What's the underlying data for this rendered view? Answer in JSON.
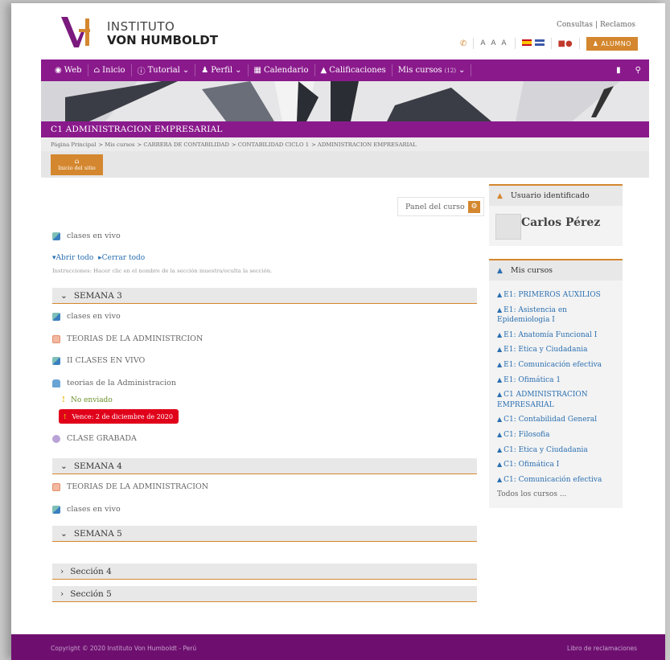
{
  "header": {
    "logo_line1": "INSTITUTO",
    "logo_line2": "VON HUMBOLDT",
    "consultas": "Consultas",
    "reclamos": "Reclamos",
    "font_size_label": "A A A",
    "alumno_button": "ALUMNO"
  },
  "nav": {
    "items": [
      "Web",
      "Inicio",
      "Tutorial",
      "Perfil",
      "Calendario",
      "Calificaciones",
      "Mis cursos"
    ],
    "mis_cursos_count": "(12)"
  },
  "course": {
    "title": "C1 ADMINISTRACION EMPRESARIAL",
    "breadcrumb": [
      "Página Principal",
      "> Mis cursos",
      "> CARRERA DE CONTABILIDAD",
      "> CONTABILIDAD CICLO 1",
      "> ADMINISTRACION EMPRESARIAL"
    ],
    "home_button": "Inicio del sitio"
  },
  "main": {
    "panel_button": "Panel del curso",
    "top_activity": "clases en vivo",
    "expand_all": "Abrir todo",
    "collapse_all": "Cerrar todo",
    "instructions": "Instrucciones: Hacer clic en el nombre de la sección muestra/oculta la sección.",
    "sections": [
      {
        "title": "SEMANA 3",
        "activities": [
          "clases en vivo",
          "TEORIAS DE LA ADMINISTRCION",
          "II CLASES EN VIVO",
          "teorias de la Administracion",
          "CLASE GRABADA"
        ],
        "status": "No enviado",
        "due": "Vence: 2 de diciembre de 2020"
      },
      {
        "title": "SEMANA 4",
        "activities": [
          "TEORIAS DE LA ADMINISTRACION",
          "clases en vivo"
        ]
      },
      {
        "title": "SEMANA 5"
      },
      {
        "title": "Sección 4"
      },
      {
        "title": "Sección 5"
      }
    ]
  },
  "sidebar": {
    "user_block_title": "Usuario identificado",
    "user_name": "Carlos Pérez",
    "courses_block_title": "Mis cursos",
    "courses": [
      "E1: PRIMEROS AUXILIOS",
      "E1: Asistencia en Epidemiologia I",
      "E1: Anatomía Funcional I",
      "E1: Etica y Ciudadania",
      "E1: Comunicación efectiva",
      "E1: Ofimática 1",
      "C1 ADMINISTRACION EMPRESARIAL",
      "C1: Contabilidad General",
      "C1: Filosofia",
      "C1: Etica y Ciudadania",
      "C1: Ofimática I",
      "C1: Comunicación efectiva"
    ],
    "all_courses": "Todos los cursos ..."
  },
  "footer": {
    "copyright": "Copyright © 2020 Instituto Von Humboldt - Perú",
    "complaints": "Libro de reclamaciones"
  },
  "colors": {
    "purple": "#8a1a8c",
    "orange": "#d4872e",
    "link": "#2a6fb0",
    "due_red": "#e0001a"
  }
}
